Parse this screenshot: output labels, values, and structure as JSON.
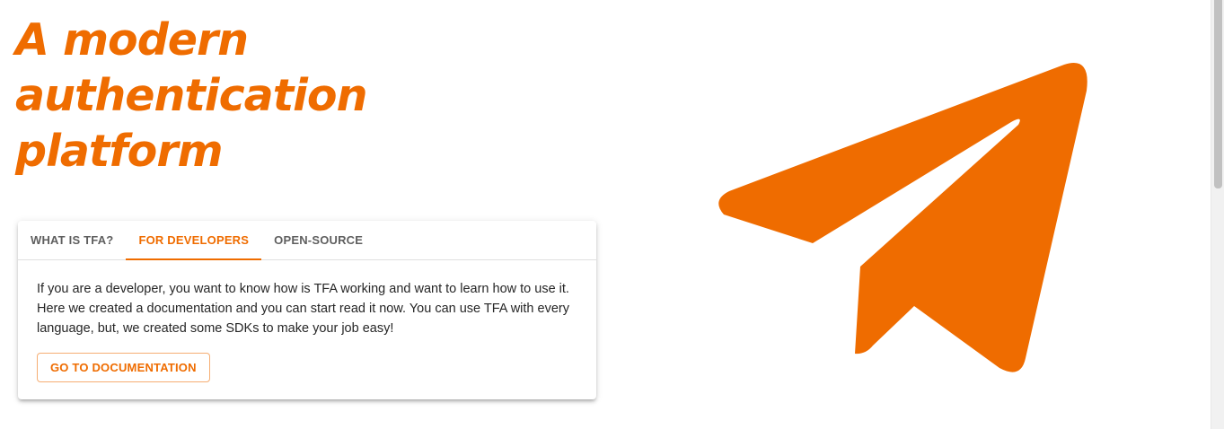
{
  "hero": {
    "title_lines": [
      "A modern",
      "authentication",
      "platform"
    ]
  },
  "tabs": [
    {
      "label": "WHAT IS TFA?",
      "active": false
    },
    {
      "label": "FOR DEVELOPERS",
      "active": true
    },
    {
      "label": "OPEN-SOURCE",
      "active": false
    }
  ],
  "panel": {
    "text": "If you are a developer, you want to know how is TFA working and want to learn how to use it. Here we created a documentation and you can start read it now. You can use TFA with every language, but, we created some SDKs to make your job easy!",
    "button_label": "GO TO DOCUMENTATION"
  },
  "illustration": {
    "icon": "paper-plane-icon",
    "color": "#ef6c00"
  },
  "theme": {
    "accent": "#ef6c00",
    "tab_inactive": "#5f5f5f",
    "text": "#262626"
  }
}
